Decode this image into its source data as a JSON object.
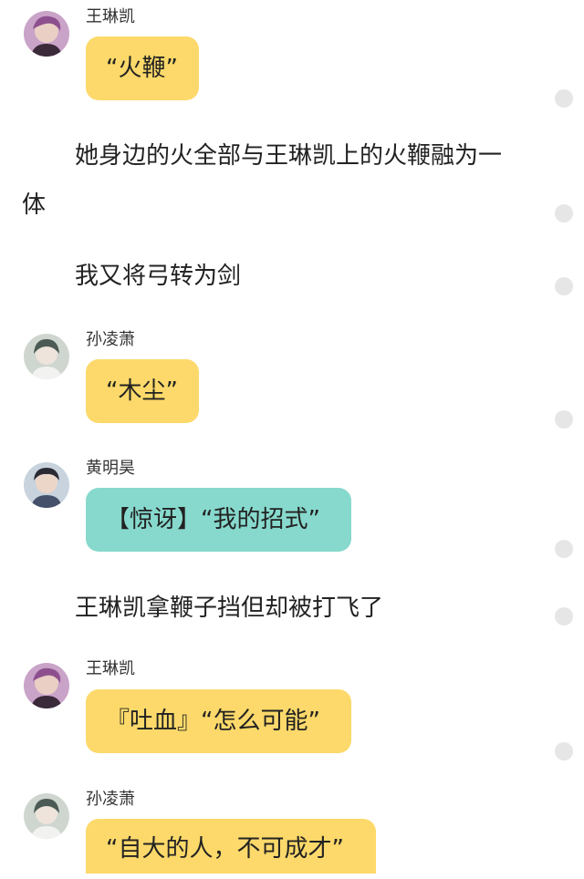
{
  "messages": {
    "m1": {
      "name": "王琳凯",
      "text": "“火鞭”"
    },
    "n1": {
      "line1": "她身边的火全部与王琳凯上的火鞭融为一",
      "line2": "体"
    },
    "n2": {
      "text": "我又将弓转为剑"
    },
    "m2": {
      "name": "孙凌萧",
      "text": "“木尘”"
    },
    "m3": {
      "name": "黄明昊",
      "text": "【惊讶】“我的招式”"
    },
    "n3": {
      "text": "王琳凯拿鞭子挡但却被打飞了"
    },
    "m4": {
      "name": "王琳凯",
      "text": "『吐血』“怎么可能”"
    },
    "m5": {
      "name": "孙凌萧",
      "text": "“自大的人，不可成才”"
    }
  },
  "colors": {
    "yellow_bubble": "#fcd96a",
    "teal_bubble": "#87d9cd",
    "side_dot": "#e6e6e6"
  },
  "icons": {
    "avatar_wang": "avatar-icon",
    "avatar_sun": "avatar-icon",
    "avatar_huang": "avatar-icon",
    "side_dot": "circle-icon"
  }
}
